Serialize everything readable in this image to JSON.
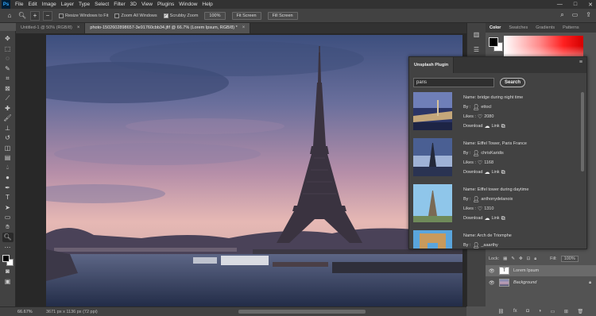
{
  "menubar": {
    "logo": "Ps",
    "items": [
      "File",
      "Edit",
      "Image",
      "Layer",
      "Type",
      "Select",
      "Filter",
      "3D",
      "View",
      "Plugins",
      "Window",
      "Help"
    ],
    "window_controls": [
      "—",
      "□",
      "✕"
    ]
  },
  "options": {
    "resize_windows": "Resize Windows to Fit",
    "zoom_all": "Zoom All Windows",
    "scrubby_zoom": "Scrubby Zoom",
    "zoom_value": "100%",
    "fit_screen": "Fit Screen",
    "fill_screen": "Fill Screen"
  },
  "tabs": [
    {
      "label": "Untitled-1 @ 50% (RGB/8)",
      "close": "×"
    },
    {
      "label": "photo-1502602898657-3e91760cbb34.jfif @ 66.7% (Lorem Ipsum, RGB/8) *",
      "close": "×"
    }
  ],
  "status": {
    "zoom": "66.67%",
    "doc_info": "3671 px x 1136 px (72 ppi)"
  },
  "color_panel": {
    "tabs": [
      "Color",
      "Swatches",
      "Gradients",
      "Patterns"
    ]
  },
  "plugin": {
    "title": "Unsplash Plugin",
    "search_value": "paris",
    "search_button": "Search",
    "results": [
      {
        "name": "Name: bridge during night time",
        "by": "By :",
        "user": "ettocl",
        "likes_label": "Likes :",
        "likes": "2080",
        "download": "Download",
        "link": "Link"
      },
      {
        "name": "Name: Eiffel Tower, Paris France",
        "by": "By :",
        "user": "chrisKaridis",
        "likes_label": "Likes :",
        "likes": "1168",
        "download": "Download",
        "link": "Link"
      },
      {
        "name": "Name: Eiffel tower during daytime",
        "by": "By :",
        "user": "anthonydelanoix",
        "likes_label": "Likes :",
        "likes": "1310",
        "download": "Download",
        "link": "Link"
      },
      {
        "name": "Name: Arch de Triomphe",
        "by": "By :",
        "user": "_aaarthy",
        "likes_label": "Likes :",
        "likes": "",
        "download": "Download",
        "link": "Link"
      }
    ]
  },
  "layers": {
    "lock_label": "Lock:",
    "fill_label": "Fill:",
    "fill_value": "100%",
    "items": [
      {
        "name": "Lorem Ipsum",
        "thumb": "T"
      },
      {
        "name": "Background",
        "thumb": ""
      }
    ]
  }
}
